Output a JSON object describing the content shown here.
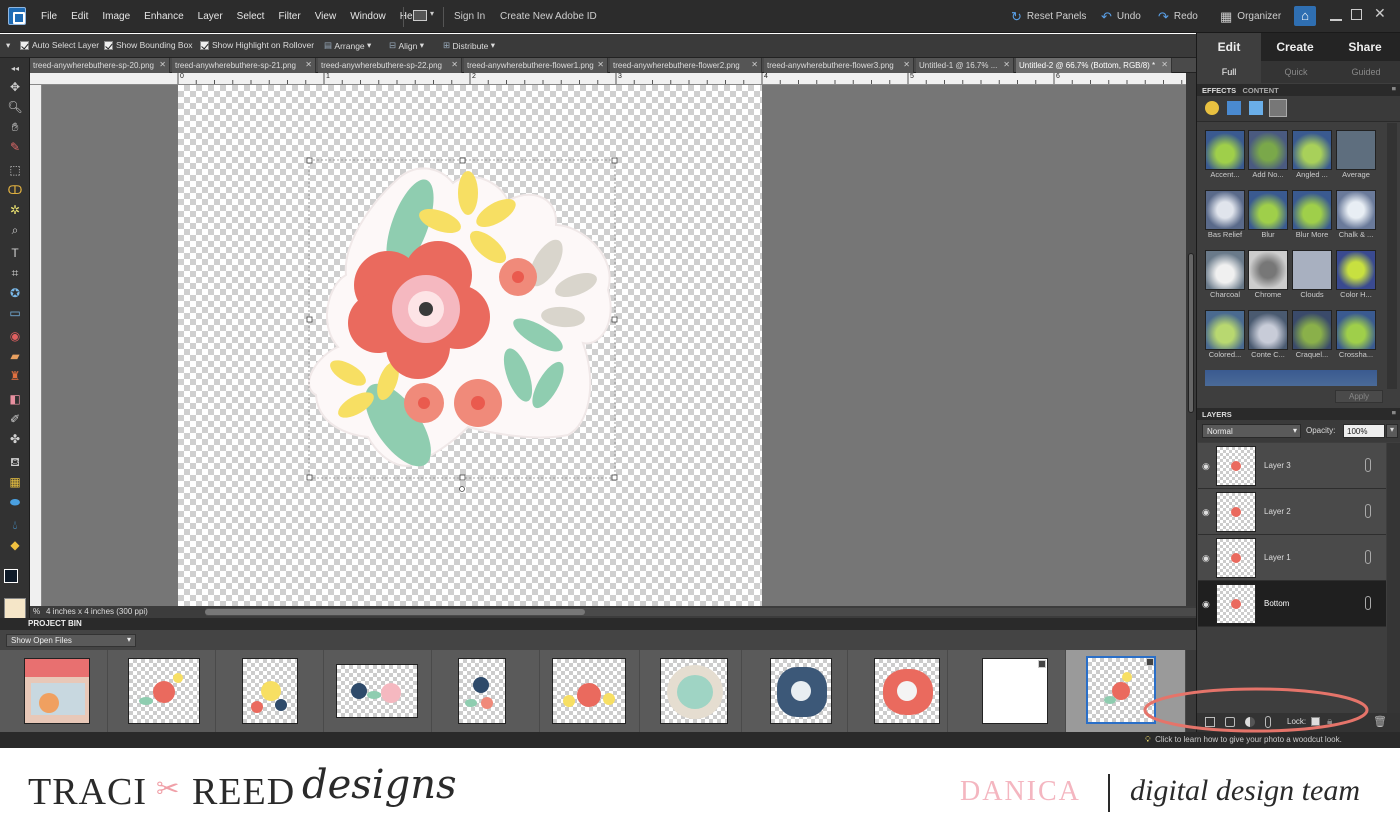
{
  "menu": [
    "File",
    "Edit",
    "Image",
    "Enhance",
    "Layer",
    "Select",
    "Filter",
    "View",
    "Window",
    "Help"
  ],
  "top_actions": {
    "sign_in": "Sign In",
    "create_id": "Create New Adobe ID",
    "reset_panels": "Reset Panels",
    "undo": "Undo",
    "redo": "Redo",
    "organizer": "Organizer"
  },
  "options": {
    "auto_select": "Auto Select Layer",
    "bounding_box": "Show Bounding Box",
    "highlight": "Show Highlight on Rollover",
    "arrange": "Arrange",
    "align": "Align",
    "distribute": "Distribute"
  },
  "tabs": [
    {
      "label": "treed-anywherebuthere-sp-20.png"
    },
    {
      "label": "treed-anywherebuthere-sp-21.png"
    },
    {
      "label": "treed-anywherebuthere-sp-22.png"
    },
    {
      "label": "treed-anywherebuthere-flower1.png"
    },
    {
      "label": "treed-anywherebuthere-flower2.png"
    },
    {
      "label": "treed-anywherebuthere-flower3.png"
    },
    {
      "label": "Untitled-1 @ 16.7% ..."
    },
    {
      "label": "Untitled-2 @ 66.7% (Bottom, RGB/8) *"
    }
  ],
  "ruler_labels": [
    "0",
    "1",
    "2",
    "3",
    "4",
    "5",
    "6"
  ],
  "status": {
    "doc_size": "4 inches x 4 inches (300 ppi)",
    "zoom": "%"
  },
  "bin": {
    "title": "PROJECT BIN",
    "dropdown": "Show Open Files"
  },
  "modes": {
    "edit": "Edit",
    "create": "Create",
    "share": "Share",
    "full": "Full",
    "quick": "Quick",
    "guided": "Guided"
  },
  "effects": {
    "tab_effects": "EFFECTS",
    "tab_content": "CONTENT",
    "apply": "Apply",
    "items": [
      "Accent...",
      "Add No...",
      "Angled ...",
      "Average",
      "Bas Relief",
      "Blur",
      "Blur More",
      "Chalk & ...",
      "Charcoal",
      "Chrome",
      "Clouds",
      "Color H...",
      "Colored...",
      "Conte C...",
      "Craquel...",
      "Crossha..."
    ]
  },
  "layers": {
    "title": "LAYERS",
    "blend": "Normal",
    "opacity_label": "Opacity:",
    "opacity": "100%",
    "lock": "Lock:",
    "items": [
      {
        "name": "Layer 3"
      },
      {
        "name": "Layer 2"
      },
      {
        "name": "Layer 1"
      },
      {
        "name": "Bottom"
      }
    ]
  },
  "tip": "Click to learn how to give your photo a woodcut look.",
  "brand": {
    "logo_traci": "TRACI",
    "logo_reed": "REED",
    "logo_designs": "designs",
    "member": "DANICA",
    "team": "digital design team"
  },
  "colors": {
    "accent": "#e5746a",
    "coral": "#ea6a5e",
    "pink": "#f5b8c0",
    "yellow": "#f7df63",
    "mint": "#8fcdb0",
    "sage": "#d9d5cc"
  }
}
